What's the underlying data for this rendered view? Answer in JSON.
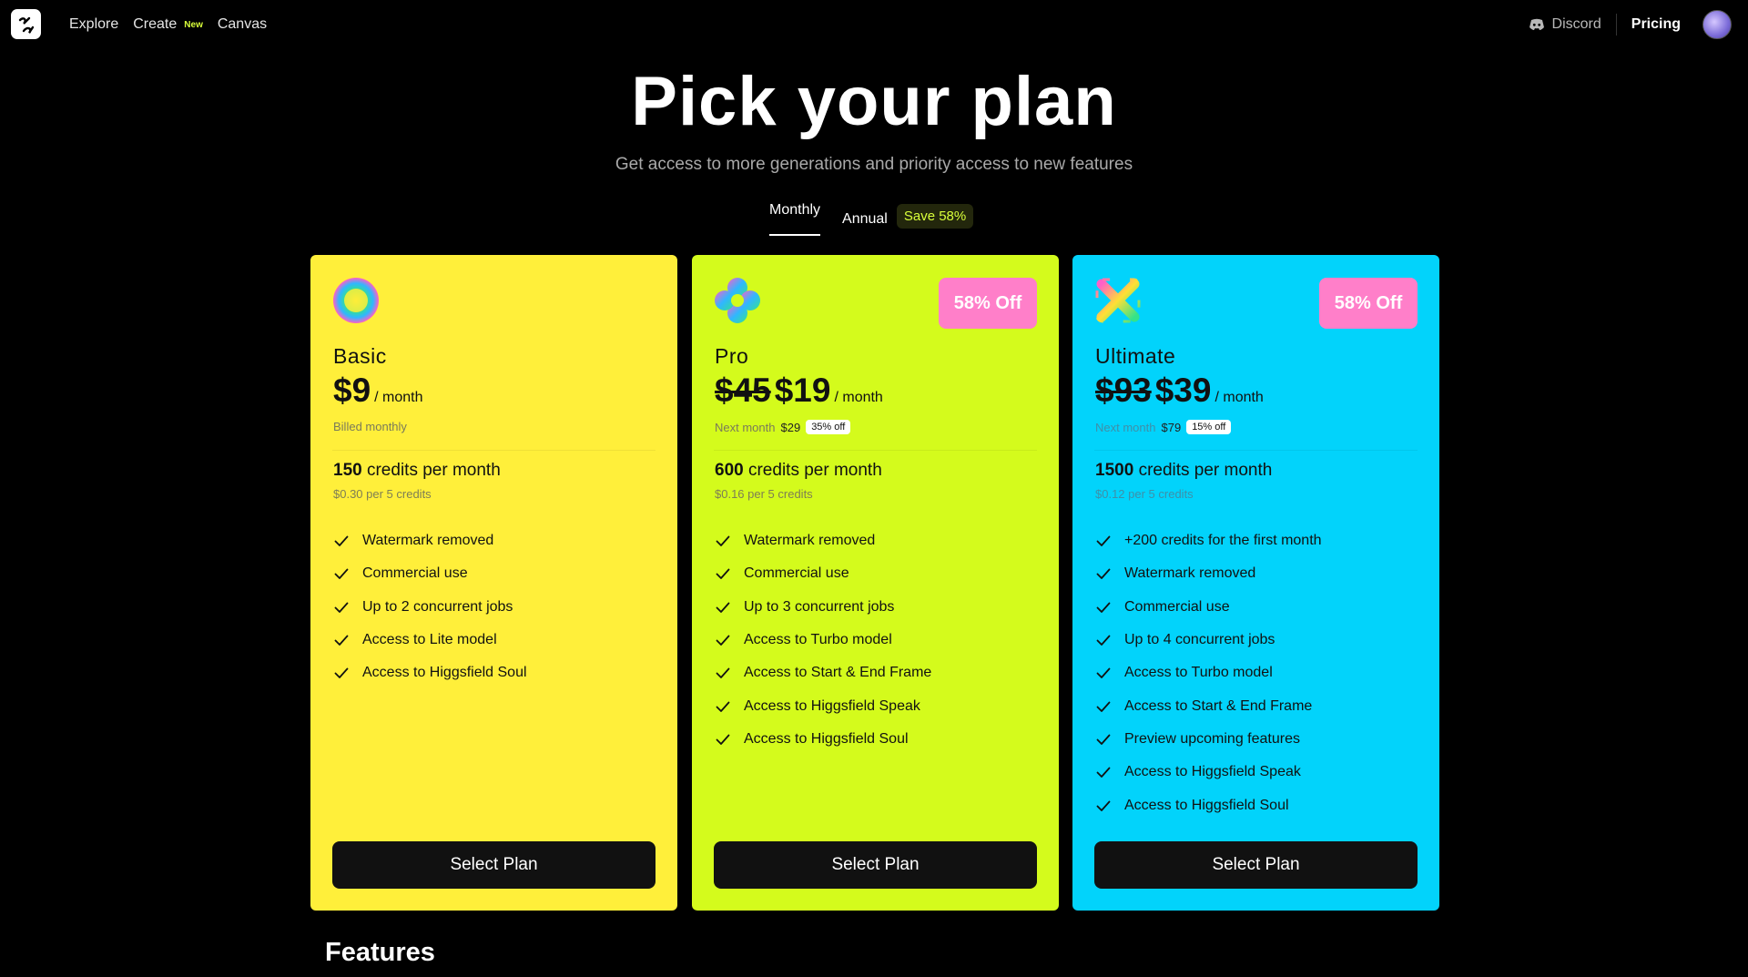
{
  "nav": {
    "explore": "Explore",
    "create": "Create",
    "create_badge": "New",
    "canvas": "Canvas",
    "discord": "Discord",
    "pricing": "Pricing"
  },
  "hero": {
    "title": "Pick your plan",
    "subtitle": "Get access to more generations and priority access to new features"
  },
  "billing_toggle": {
    "monthly": "Monthly",
    "annual": "Annual",
    "save_badge": "Save 58%",
    "selected": "Monthly"
  },
  "plans": [
    {
      "name": "Basic",
      "price": "$9",
      "per": "/ month",
      "billing_note": "Billed monthly",
      "credits": "150",
      "credits_suffix": "credits per month",
      "per_credit": "$0.30 per 5 credits",
      "features": [
        "Watermark removed",
        "Commercial use",
        "Up to 2 concurrent jobs",
        "Access to Lite model",
        "Access to Higgsfield Soul"
      ],
      "button": "Select Plan",
      "color": "#ffef3a"
    },
    {
      "name": "Pro",
      "old_price": "$45",
      "price": "$19",
      "per": "/ month",
      "discount_badge": "58% Off",
      "next_month_label": "Next month",
      "next_month_price": "$29",
      "next_month_badge": "35% off",
      "credits": "600",
      "credits_suffix": "credits per month",
      "per_credit": "$0.16 per 5 credits",
      "features": [
        "Watermark removed",
        "Commercial use",
        "Up to 3 concurrent jobs",
        "Access to Turbo model",
        "Access to Start & End Frame",
        "Access to Higgsfield Speak",
        "Access to Higgsfield Soul"
      ],
      "button": "Select Plan",
      "color": "#d4fb1c"
    },
    {
      "name": "Ultimate",
      "old_price": "$93",
      "price": "$39",
      "per": "/ month",
      "discount_badge": "58% Off",
      "next_month_label": "Next month",
      "next_month_price": "$79",
      "next_month_badge": "15% off",
      "credits": "1500",
      "credits_suffix": "credits per month",
      "per_credit": "$0.12 per 5 credits",
      "features": [
        "+200 credits for the first month",
        "Watermark removed",
        "Commercial use",
        "Up to 4 concurrent jobs",
        "Access to Turbo model",
        "Access to Start & End Frame",
        "Preview upcoming features",
        "Access to Higgsfield Speak",
        "Access to Higgsfield Soul"
      ],
      "button": "Select Plan",
      "color": "#02d3fb"
    }
  ],
  "features_heading": "Features",
  "accent": {
    "badge_pink": "#ff7fc9",
    "new_lime": "#d9ff3a"
  }
}
